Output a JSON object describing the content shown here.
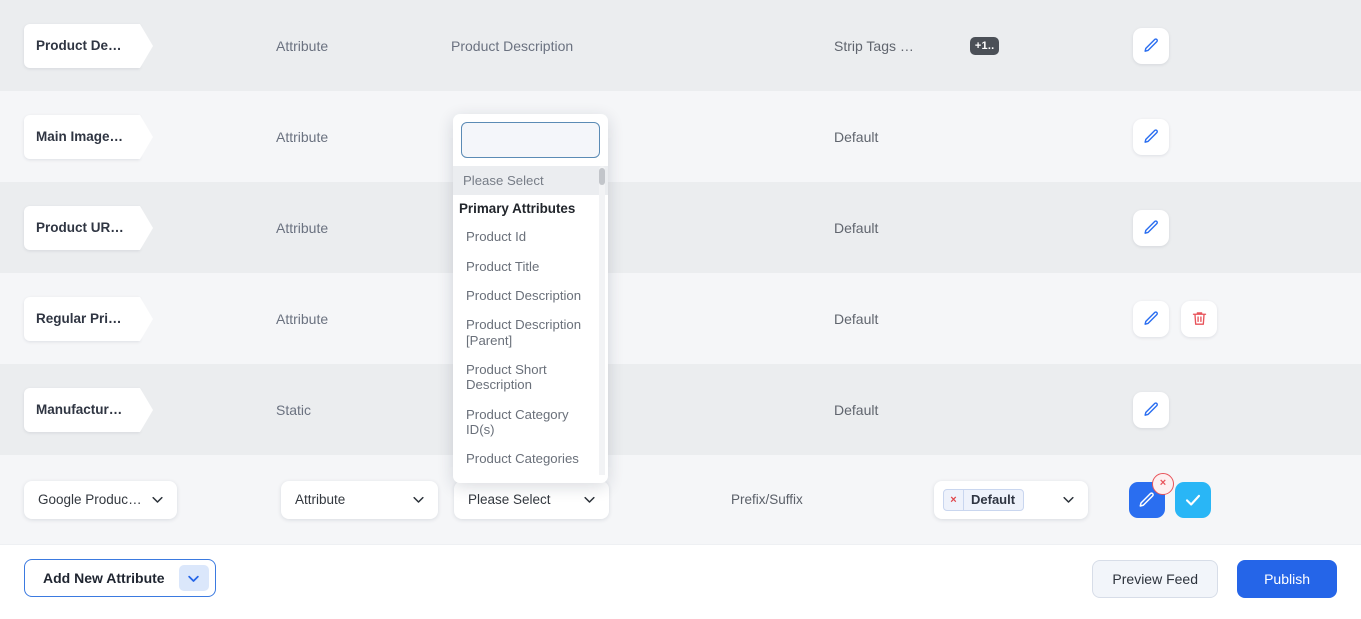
{
  "rows": [
    {
      "name": "Product Desc…",
      "type": "Attribute",
      "value": "Product Description",
      "modifier": "Strip Tags  …",
      "modifier_count": "+1..",
      "actions": [
        "edit"
      ]
    },
    {
      "name": "Main Image […",
      "type": "Attribute",
      "value": "",
      "modifier": "Default",
      "modifier_count": "",
      "actions": [
        "edit"
      ]
    },
    {
      "name": "Product URL …",
      "type": "Attribute",
      "value": "",
      "modifier": "Default",
      "modifier_count": "",
      "actions": [
        "edit"
      ]
    },
    {
      "name": "Regular Price…",
      "type": "Attribute",
      "value": "",
      "modifier": "Default",
      "modifier_count": "",
      "actions": [
        "edit",
        "delete"
      ]
    },
    {
      "name": "Manufacture…",
      "type": "Static",
      "value": "",
      "modifier": "Default",
      "modifier_count": "",
      "actions": [
        "edit"
      ]
    }
  ],
  "edit_row": {
    "attribute_name": "Google Product …",
    "source_type": "Attribute",
    "source_value": "Please Select",
    "modifier_label": "Prefix/Suffix",
    "modifier_chip": "Default",
    "chip_remove": "×",
    "save_icon": "check-icon",
    "edit_icon": "pencil-icon",
    "delete_badge": "×"
  },
  "dropdown": {
    "search_value": "",
    "search_placeholder": "",
    "placeholder_option": "Please Select",
    "group_label": "Primary Attributes",
    "options": [
      "Product Id",
      "Product Title",
      "Product Description",
      "Product Description [Parent]",
      "Product Short Description",
      "Product Category ID(s)",
      "Product Categories"
    ]
  },
  "footer": {
    "add_label": "Add New Attribute",
    "add_chevron": "chevron-down-icon",
    "preview_label": "Preview Feed",
    "publish_label": "Publish"
  },
  "colors": {
    "primary_blue": "#2565e8",
    "accent_blue": "#2a6ef0",
    "confirm_blue": "#29b6f6",
    "danger_red": "#e8535a",
    "row_shade_a": "#ebedef",
    "row_shade_b": "#f5f6f8",
    "badge_dark": "#4b5057"
  }
}
